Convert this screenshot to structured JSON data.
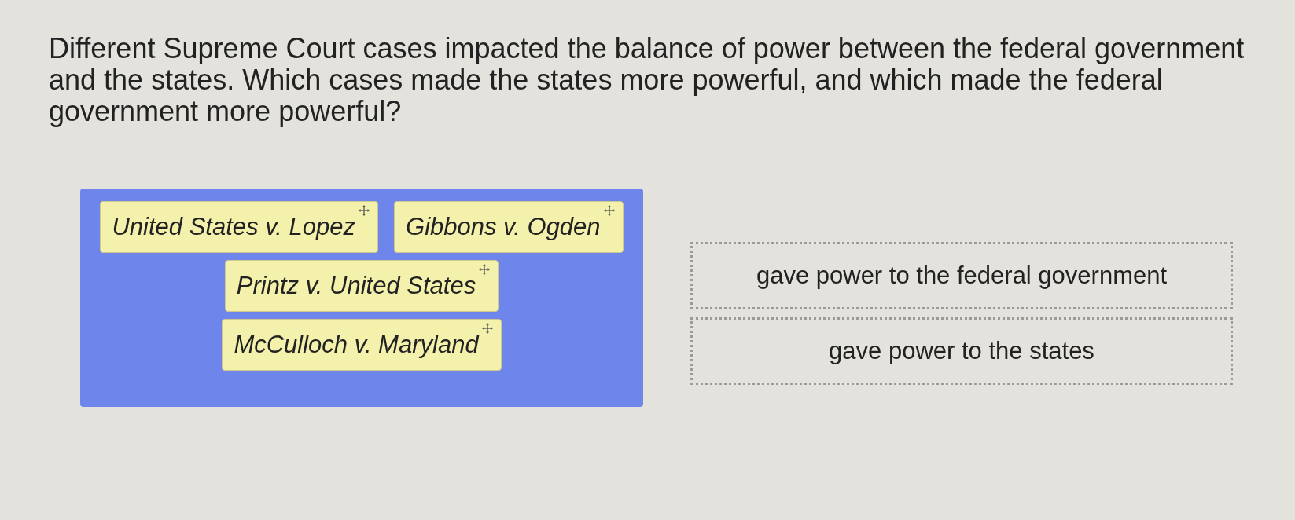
{
  "question": "Different Supreme Court cases impacted the balance of power between the federal government and the states. Which cases made the states more powerful, and which made the federal government more powerful?",
  "tiles": [
    {
      "label": "United States v. Lopez"
    },
    {
      "label": "Gibbons v. Ogden"
    },
    {
      "label": "Printz v. United States"
    },
    {
      "label": "McCulloch v. Maryland"
    }
  ],
  "drop_zones": [
    {
      "label": "gave power to the federal government"
    },
    {
      "label": "gave power to the states"
    }
  ]
}
